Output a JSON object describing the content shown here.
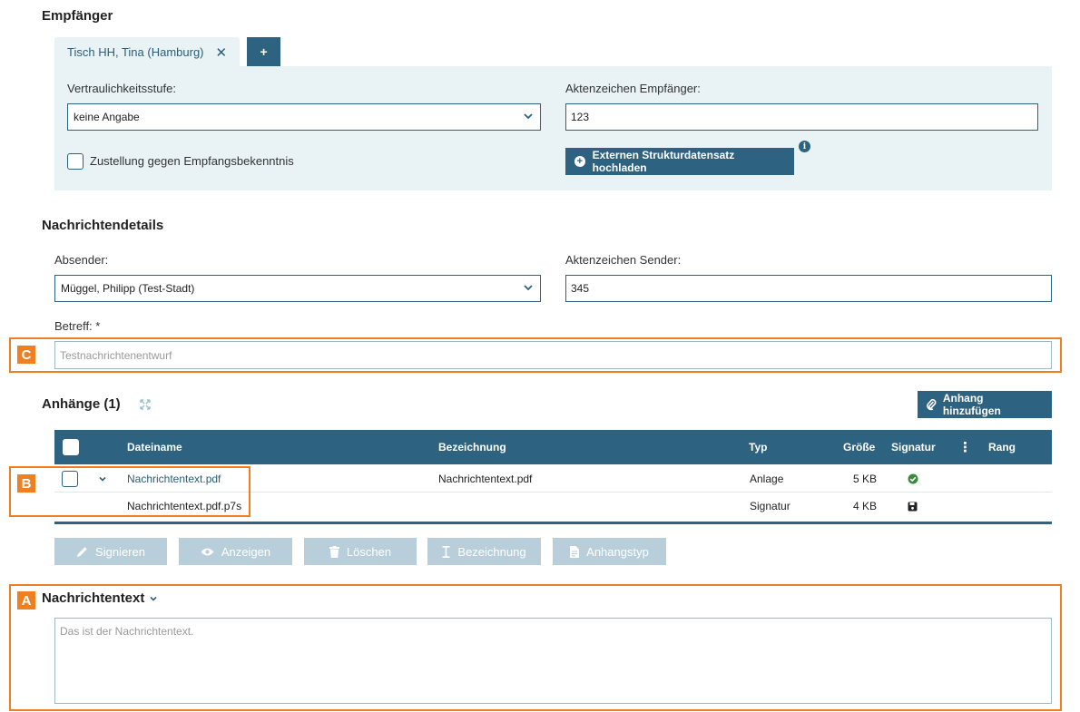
{
  "recipients": {
    "heading": "Empfänger",
    "tab": {
      "label": "Tisch HH, Tina (Hamburg)",
      "close": "✕"
    },
    "add_tab_label": "+",
    "confidentiality": {
      "label": "Vertraulichkeitsstufe:",
      "value": "keine Angabe"
    },
    "recipient_reference": {
      "label": "Aktenzeichen Empfänger:",
      "value": "123"
    },
    "acknowledgement_checkbox": {
      "label": "Zustellung gegen Empfangsbekenntnis",
      "checked": false
    },
    "upload_button": {
      "label": "Externen Strukturdatensatz hochladen",
      "icon": "plus-circle-icon"
    },
    "info_icon": "i"
  },
  "message_details": {
    "heading": "Nachrichtendetails",
    "sender": {
      "label": "Absender:",
      "value": "Müggel, Philipp (Test-Stadt)"
    },
    "sender_reference": {
      "label": "Aktenzeichen Sender:",
      "value": "345"
    },
    "subject": {
      "label": "Betreff: *",
      "placeholder": "Testnachrichtenentwurf"
    }
  },
  "attachments": {
    "heading": "Anhänge (1)",
    "add_button": "Anhang hinzufügen",
    "columns": {
      "filename": "Dateiname",
      "description": "Bezeichnung",
      "type": "Typ",
      "size": "Größe",
      "signature": "Signatur",
      "more": "⋮",
      "rank": "Rang"
    },
    "rows": [
      {
        "filename": "Nachrichtentext.pdf",
        "description": "Nachrichtentext.pdf",
        "type": "Anlage",
        "size": "5 KB",
        "signature_icon": "check-circle-icon"
      },
      {
        "filename": "Nachrichtentext.pdf.p7s",
        "description": "",
        "type": "Signatur",
        "size": "4 KB",
        "signature_icon": "save-icon"
      }
    ],
    "actions": [
      {
        "label": "Signieren",
        "icon": "pen-icon"
      },
      {
        "label": "Anzeigen",
        "icon": "eye-icon"
      },
      {
        "label": "Löschen",
        "icon": "trash-icon"
      },
      {
        "label": "Bezeichnung",
        "icon": "text-cursor-icon"
      },
      {
        "label": "Anhangstyp",
        "icon": "file-icon"
      }
    ]
  },
  "message_text": {
    "heading": "Nachrichtentext",
    "placeholder": "Das ist der Nachrichtentext."
  },
  "annotations": {
    "a": "A",
    "b": "B",
    "c": "C"
  },
  "colors": {
    "primary": "#2d6280",
    "panel": "#e9f2f5",
    "annotation": "#f07f22",
    "disabled": "#b8cfdb",
    "success": "#3a8a3e"
  }
}
